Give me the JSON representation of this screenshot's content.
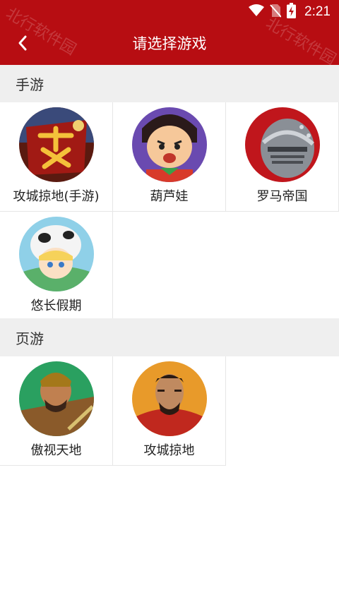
{
  "status_bar": {
    "time": "2:21",
    "icons": [
      "wifi-icon",
      "no-sim-icon",
      "battery-charging-icon"
    ]
  },
  "header": {
    "title": "请选择游戏",
    "back_icon": "chevron-left-icon",
    "watermark_left": "北行软件园",
    "watermark_right": "北行软件园"
  },
  "colors": {
    "primary": "#b70d12",
    "section_bg": "#efefef",
    "divider": "#e6e6e6"
  },
  "sections": [
    {
      "title": "手游",
      "games": [
        {
          "name": "攻城掠地(手游)"
        },
        {
          "name": "葫芦娃"
        },
        {
          "name": "罗马帝国"
        },
        {
          "name": "悠长假期"
        }
      ]
    },
    {
      "title": "页游",
      "games": [
        {
          "name": "傲视天地"
        },
        {
          "name": "攻城掠地"
        }
      ]
    }
  ]
}
